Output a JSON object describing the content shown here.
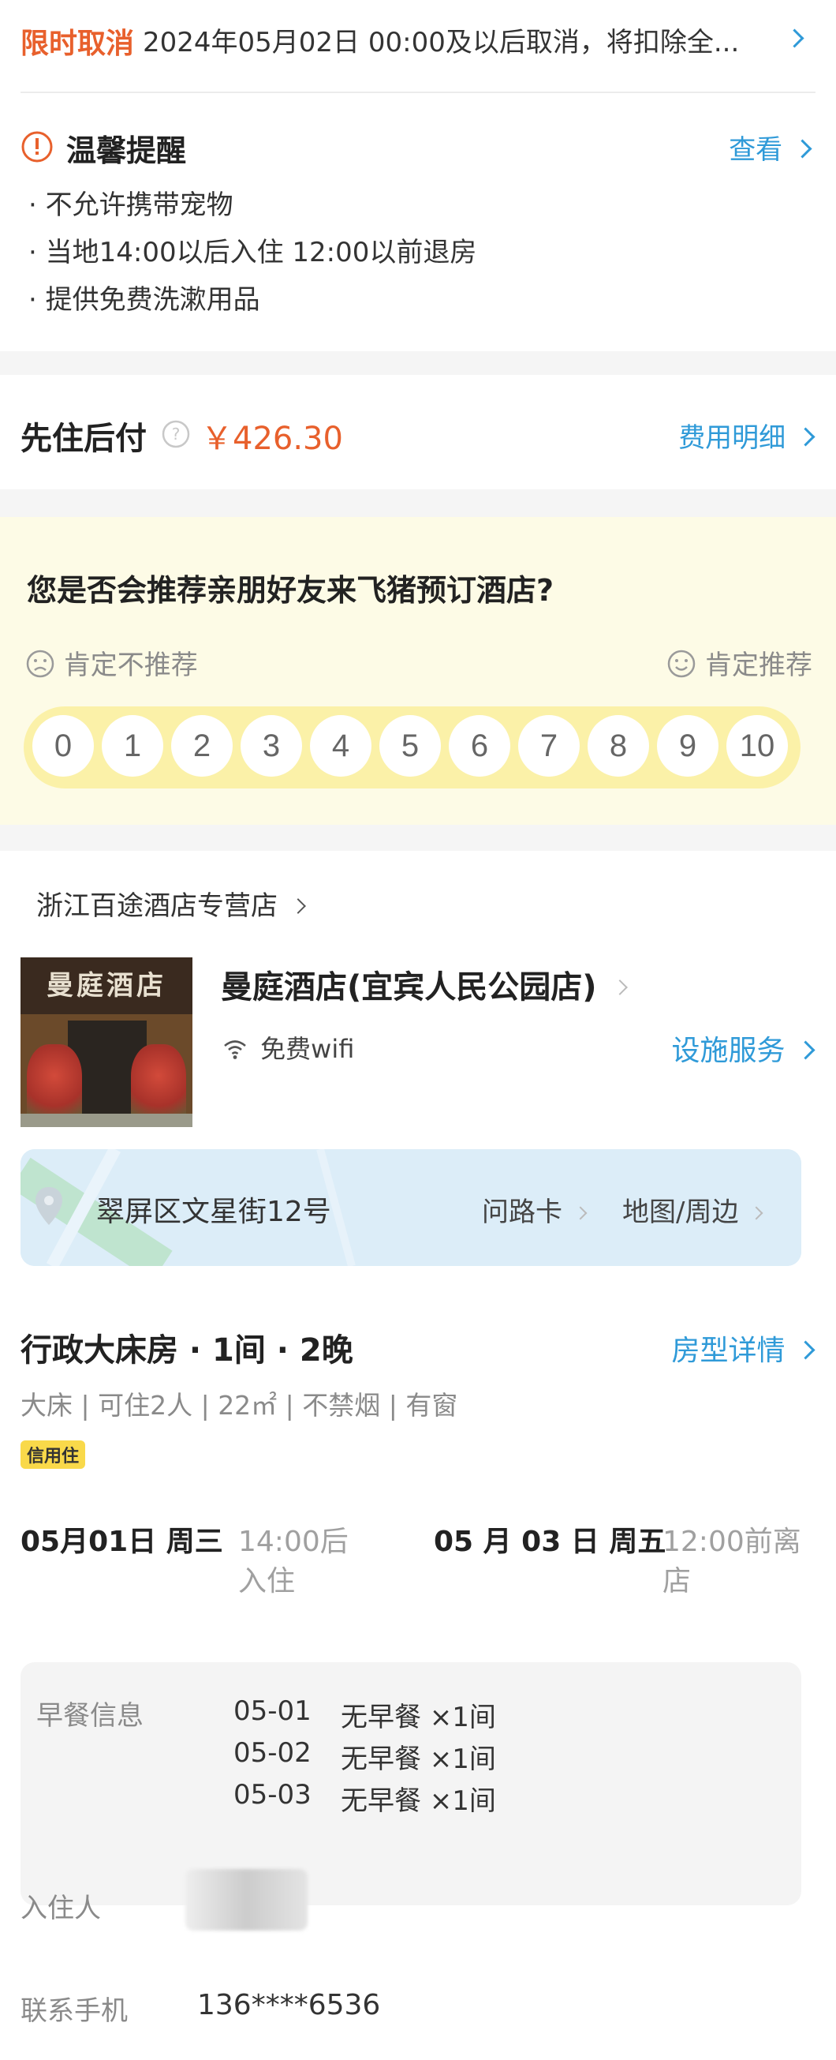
{
  "cancel": {
    "tag": "限时取消",
    "text": "2024年05月02日 00:00及以后取消，将扣除全..."
  },
  "notice": {
    "title": "温馨提醒",
    "link": "查看",
    "items": [
      "· 不允许携带宠物",
      "· 当地14:00以后入住 12:00以前退房",
      "· 提供免费洗漱用品"
    ]
  },
  "payment": {
    "label": "先住后付",
    "price": "￥426.30",
    "link": "费用明细"
  },
  "survey": {
    "question": "您是否会推荐亲朋好友来飞猪预订酒店?",
    "low_label": "肯定不推荐",
    "high_label": "肯定推荐",
    "scale": [
      "0",
      "1",
      "2",
      "3",
      "4",
      "5",
      "6",
      "7",
      "8",
      "9",
      "10"
    ]
  },
  "shop": {
    "name": "浙江百途酒店专营店"
  },
  "hotel": {
    "name": "曼庭酒店(宜宾人民公园店)",
    "wifi": "免费wifi",
    "facilities_link": "设施服务",
    "address": "翠屏区文星街12号",
    "direction_card": "问路卡",
    "map_link": "地图/周边",
    "sign_text": "曼庭酒店"
  },
  "room": {
    "title": "行政大床房 · 1间 · 2晚",
    "detail_link": "房型详情",
    "specs": "大床 | 可住2人 | 22㎡ | 不禁烟 | 有窗",
    "tag": "信用住",
    "checkin_date": "05月01日 周三",
    "checkin_time": "14:00后",
    "checkin_label": "入住",
    "checkout_date": "05 月 03 日 周五",
    "checkout_time": "12:00前离",
    "checkout_label": "店"
  },
  "breakfast": {
    "label": "早餐信息",
    "rows": [
      {
        "date": "05-01",
        "desc": "无早餐 ×1间"
      },
      {
        "date": "05-02",
        "desc": "无早餐 ×1间"
      },
      {
        "date": "05-03",
        "desc": "无早餐 ×1间"
      }
    ]
  },
  "guest": {
    "label": "入住人"
  },
  "contact": {
    "label": "联系手机",
    "phone": "136****6536"
  },
  "colors": {
    "accent_orange": "#e8602c",
    "link_blue": "#2f9ad8",
    "survey_bg": "#fdfbe6",
    "survey_bar": "#fbf1a8",
    "tag_yellow": "#f9d94a"
  }
}
